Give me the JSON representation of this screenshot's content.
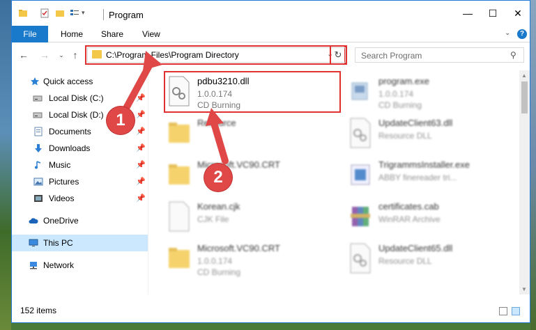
{
  "window": {
    "title": "Program",
    "minimize": "—",
    "maximize": "☐",
    "close": "✕"
  },
  "ribbon": {
    "tabs": [
      "File",
      "Home",
      "Share",
      "View"
    ],
    "help": "?"
  },
  "address": {
    "path": "C:\\Program Files\\Program Directory",
    "search_placeholder": "Search Program"
  },
  "sidebar": {
    "items": [
      {
        "label": "Quick access",
        "icon": "star-icon",
        "pinned": false
      },
      {
        "label": "Local Disk (C:)",
        "icon": "drive-icon",
        "pinned": true
      },
      {
        "label": "Local Disk (D:)",
        "icon": "drive-icon",
        "pinned": true
      },
      {
        "label": "Documents",
        "icon": "documents-icon",
        "pinned": true
      },
      {
        "label": "Downloads",
        "icon": "download-icon",
        "pinned": true
      },
      {
        "label": "Music",
        "icon": "music-icon",
        "pinned": true
      },
      {
        "label": "Pictures",
        "icon": "pictures-icon",
        "pinned": true
      },
      {
        "label": "Videos",
        "icon": "videos-icon",
        "pinned": true
      },
      {
        "label": "OneDrive",
        "icon": "cloud-icon",
        "pinned": false
      },
      {
        "label": "This PC",
        "icon": "computer-icon",
        "pinned": false
      },
      {
        "label": "Network",
        "icon": "network-icon",
        "pinned": false
      }
    ]
  },
  "files": [
    {
      "name": "pdbu3210.dll",
      "line2": "1.0.0.174",
      "line3": "CD Burning",
      "icon": "dll-gear-icon"
    },
    {
      "name": "program.exe",
      "line2": "1.0.0.174",
      "line3": "CD Burning",
      "icon": "exe-icon"
    },
    {
      "name": "Resource",
      "line2": "",
      "line3": "",
      "icon": "folder-icon"
    },
    {
      "name": "UpdateClient63.dll",
      "line2": "Resource DLL",
      "line3": "",
      "icon": "dll-gear-icon"
    },
    {
      "name": "Microsoft.VC90.CRT",
      "line2": "",
      "line3": "",
      "icon": "folder-icon"
    },
    {
      "name": "TrigrammsInstaller.exe",
      "line2": "ABBY finereader tri...",
      "line3": "",
      "icon": "installer-icon"
    },
    {
      "name": "Korean.cjk",
      "line2": "CJK File",
      "line3": "",
      "icon": "file-icon"
    },
    {
      "name": "certificates.cab",
      "line2": "WinRAR Archive",
      "line3": "",
      "icon": "winrar-icon"
    },
    {
      "name": "Microsoft.VC90.CRT",
      "line2": "1.0.0.174",
      "line3": "CD Burning",
      "icon": "folder-icon"
    },
    {
      "name": "UpdateClient65.dll",
      "line2": "Resource DLL",
      "line3": "",
      "icon": "dll-gear-icon"
    }
  ],
  "status": {
    "count": "152 items"
  },
  "callouts": [
    "1",
    "2"
  ],
  "colors": {
    "accent": "#1979ca",
    "highlight": "#e03030",
    "selected": "#cce8ff"
  }
}
